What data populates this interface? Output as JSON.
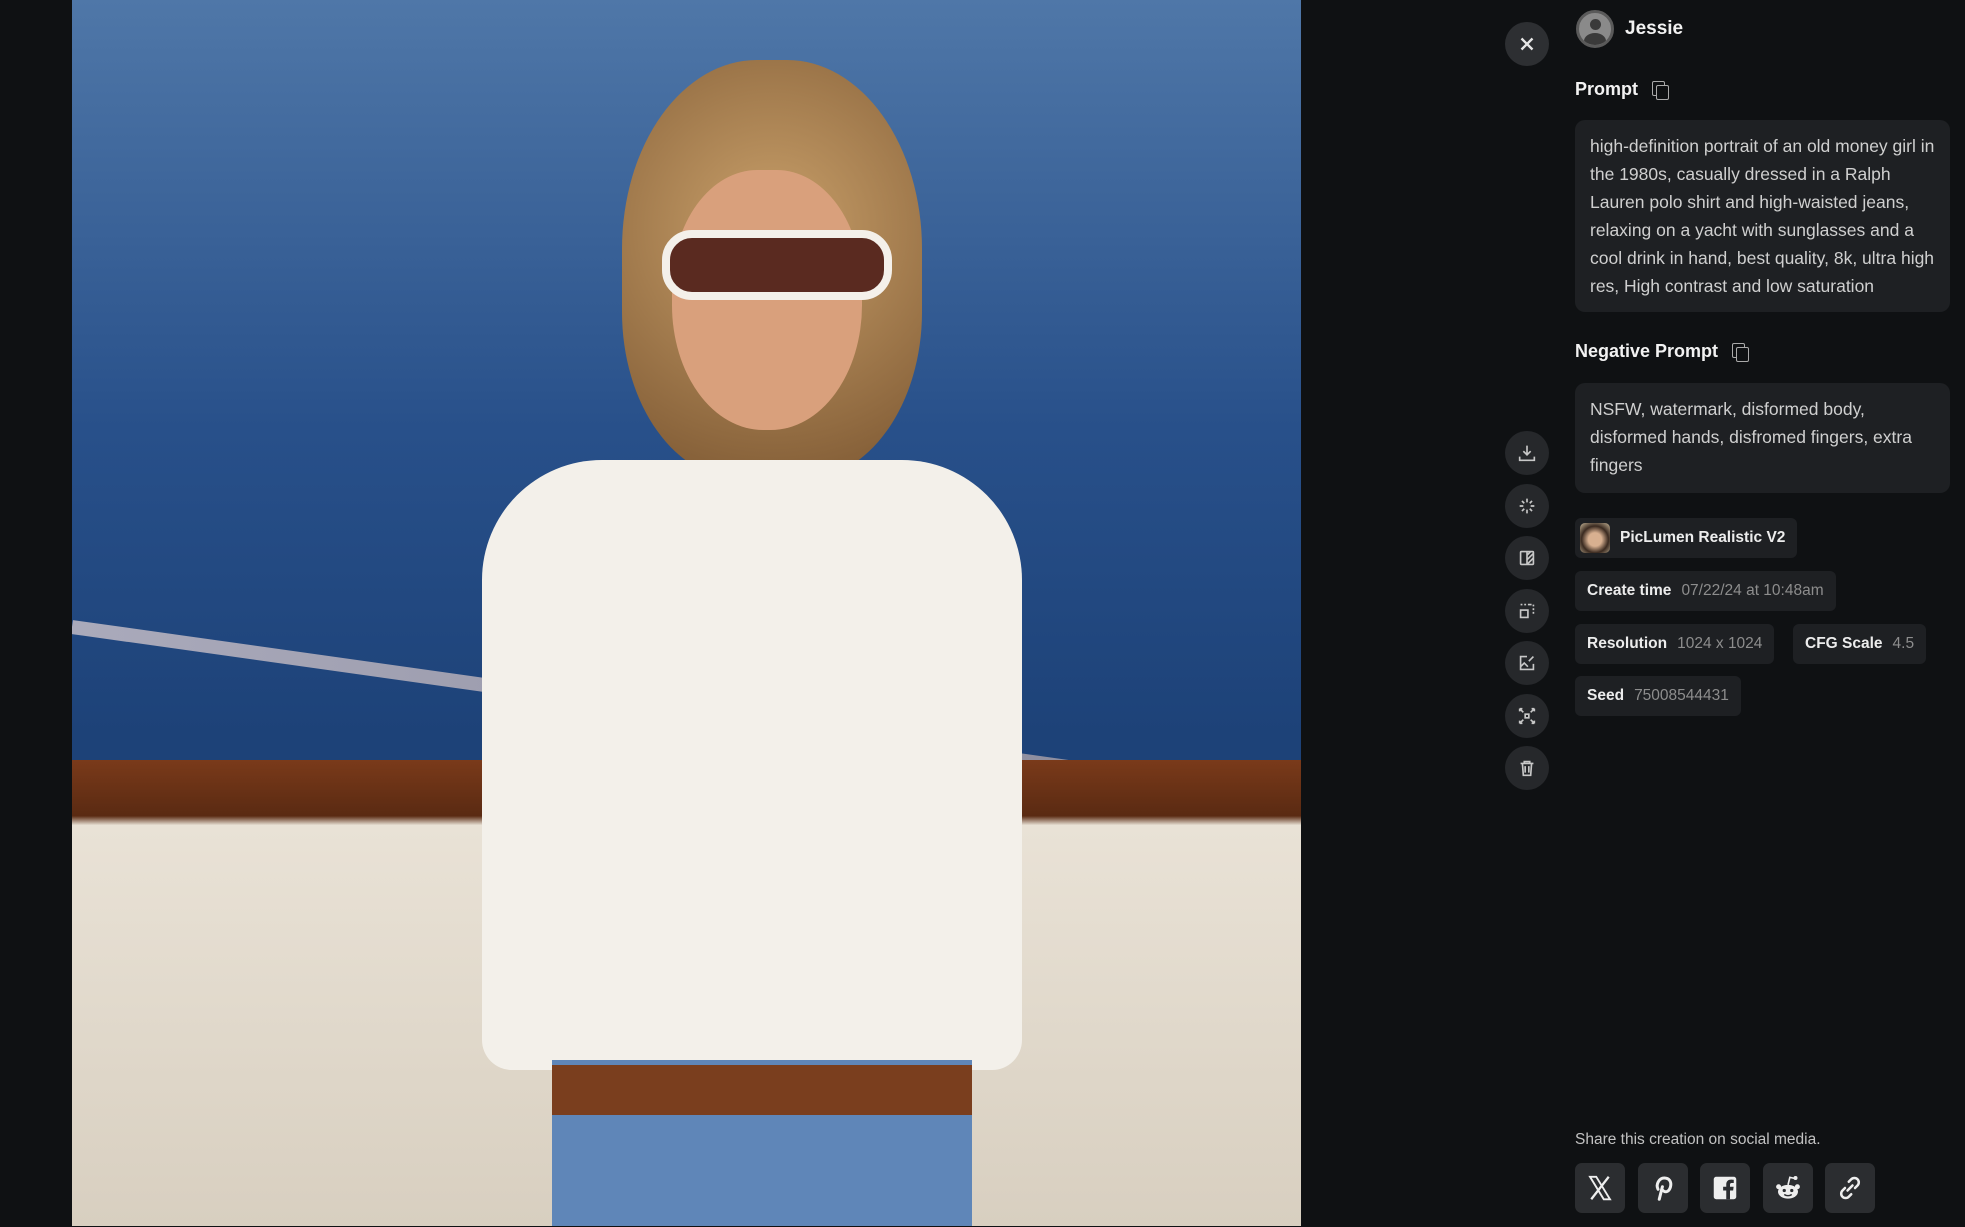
{
  "user": {
    "name": "Jessie"
  },
  "prompt": {
    "label": "Prompt",
    "text": "high-definition portrait of an old money girl in the 1980s, casually dressed in a Ralph Lauren polo shirt and high-waisted jeans, relaxing on a yacht with sunglasses and a cool drink in hand, best quality, 8k, ultra high res, High contrast and low saturation"
  },
  "negative_prompt": {
    "label": "Negative Prompt",
    "text": "NSFW, watermark, disformed body, disformed hands, disfromed fingers, extra fingers"
  },
  "model": {
    "name": "PicLumen Realistic V2"
  },
  "meta": {
    "create_time": {
      "label": "Create time",
      "value": "07/22/24 at 10:48am"
    },
    "resolution": {
      "label": "Resolution",
      "value": "1024 x 1024"
    },
    "cfg_scale": {
      "label": "CFG Scale",
      "value": "4.5"
    },
    "seed": {
      "label": "Seed",
      "value": "75008544431"
    }
  },
  "actions": [
    "download-icon",
    "sparkle-icon",
    "compare-icon",
    "upscale-icon",
    "edit-image-icon",
    "expand-icon",
    "trash-icon"
  ],
  "share": {
    "text": "Share this creation on social media.",
    "buttons": [
      "x-icon",
      "pinterest-icon",
      "facebook-icon",
      "reddit-icon",
      "link-icon"
    ]
  }
}
